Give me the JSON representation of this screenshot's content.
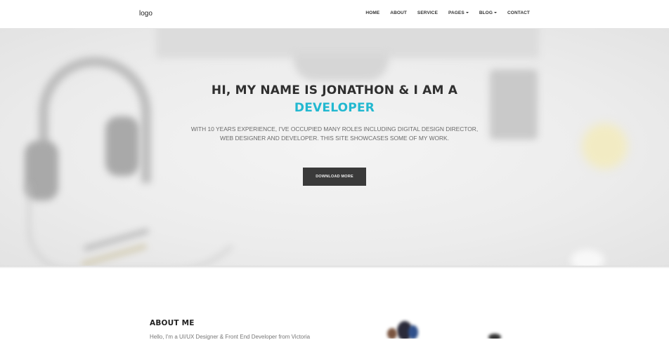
{
  "navbar": {
    "logo": "logo",
    "items": [
      {
        "label": "HOME"
      },
      {
        "label": "ABOUT"
      },
      {
        "label": "SERVICE"
      },
      {
        "label": "PAGES"
      },
      {
        "label": "BLOG"
      },
      {
        "label": "CONTACT"
      }
    ]
  },
  "hero": {
    "title_line1": "HI, MY NAME IS JONATHON & I AM A",
    "title_line2": "DEVELOPER",
    "subtitle_line1": "WITH 10 YEARS EXPERIENCE, I'VE OCCUPIED MANY ROLES INCLUDING DIGITAL DESIGN DIRECTOR,",
    "subtitle_line2": "WEB DESIGNER AND DEVELOPER. THIS SITE SHOWCASES SOME OF MY WORK.",
    "button_label": "DOWNLOAD MORE",
    "accent_color": "#22b8d0"
  },
  "about": {
    "title": "ABOUT ME",
    "intro": "Hello, I'm a UI/UX Designer & Front End Developer from Victoria"
  }
}
